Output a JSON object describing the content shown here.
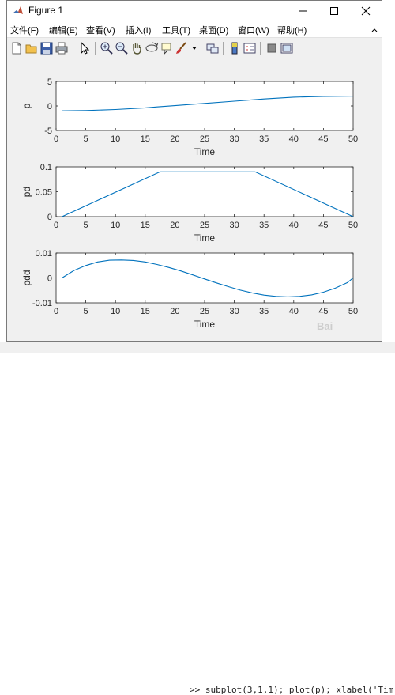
{
  "window": {
    "title": "Figure 1"
  },
  "menu": [
    "文件(F)",
    "编辑(E)",
    "查看(V)",
    "插入(I)",
    "工具(T)",
    "桌面(D)",
    "窗口(W)",
    "帮助(H)"
  ],
  "background": {
    "code": ">> subplot(3,1,1); plot(p); xlabel('Tim"
  },
  "watermark": "Bai",
  "chart_data": [
    {
      "type": "line",
      "xlabel": "Time",
      "ylabel": "p",
      "xlim": [
        0,
        50
      ],
      "ylim": [
        -5,
        5
      ],
      "xticks": [
        "0",
        "5",
        "10",
        "15",
        "20",
        "25",
        "30",
        "35",
        "40",
        "45",
        "50"
      ],
      "yticks": [
        "-5",
        "0",
        "5"
      ],
      "x": [
        1,
        5,
        10,
        15,
        17,
        20,
        25,
        30,
        33,
        35,
        40,
        45,
        50
      ],
      "y": [
        -1.0,
        -0.93,
        -0.72,
        -0.38,
        -0.2,
        0.07,
        0.52,
        0.97,
        1.24,
        1.42,
        1.79,
        1.95,
        2.0
      ]
    },
    {
      "type": "line",
      "xlabel": "Time",
      "ylabel": "pd",
      "xlim": [
        0,
        50
      ],
      "ylim": [
        0,
        0.1
      ],
      "xticks": [
        "0",
        "5",
        "10",
        "15",
        "20",
        "25",
        "30",
        "35",
        "40",
        "45",
        "50"
      ],
      "yticks": [
        "0",
        "0.05",
        "0.1"
      ],
      "x": [
        1,
        17.5,
        33.5,
        50
      ],
      "y": [
        0,
        0.09,
        0.09,
        0
      ]
    },
    {
      "type": "line",
      "xlabel": "Time",
      "ylabel": "pdd",
      "xlim": [
        0,
        50
      ],
      "ylim": [
        -0.01,
        0.01
      ],
      "xticks": [
        "0",
        "5",
        "10",
        "15",
        "20",
        "25",
        "30",
        "35",
        "40",
        "45",
        "50"
      ],
      "yticks": [
        "-0.01",
        "0",
        "0.01"
      ],
      "x": [
        1,
        3,
        5,
        7,
        9,
        11,
        13,
        15,
        17,
        19,
        21,
        23,
        25,
        27,
        29,
        31,
        33,
        35,
        37,
        39,
        41,
        43,
        45,
        47,
        49,
        50
      ],
      "y": [
        0,
        0.003,
        0.005,
        0.0064,
        0.0071,
        0.0072,
        0.007,
        0.0064,
        0.0054,
        0.0042,
        0.0028,
        0.0012,
        -0.0004,
        -0.002,
        -0.0035,
        -0.0049,
        -0.006,
        -0.0069,
        -0.0074,
        -0.0076,
        -0.0074,
        -0.0068,
        -0.0057,
        -0.0041,
        -0.0019,
        0.0
      ]
    }
  ]
}
